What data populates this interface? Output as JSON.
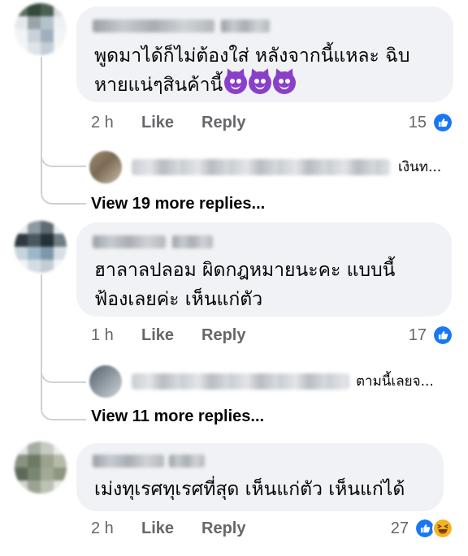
{
  "comments": [
    {
      "text_lines": [
        "พูดมาได้ก็ไม่ต้องใส่ หลังจากนี้แหละ ฉิบ",
        "หายแน่ๆสินค้านี้"
      ],
      "emoji": [
        "smiling-face-with-horns-emoji",
        "smiling-face-with-horns-emoji",
        "smiling-face-with-horns-emoji"
      ],
      "time": "2 h",
      "like_label": "Like",
      "reply_label": "Reply",
      "reaction_count": "15",
      "reactions": [
        "like-icon"
      ],
      "reply_preview_snippet": "เงินท...",
      "view_more": "View 19 more replies..."
    },
    {
      "text_lines": [
        "ฮาลาลปลอม  ผิดกฎหมายนะคะ  แบบนี้",
        "ฟ้องเลยค่ะ  เห็นแก่ตัว"
      ],
      "time": "1 h",
      "like_label": "Like",
      "reply_label": "Reply",
      "reaction_count": "17",
      "reactions": [
        "like-icon"
      ],
      "reply_preview_snippet": "ตามนี้เลยจ...",
      "view_more": "View 11 more replies..."
    },
    {
      "text_lines": [
        "เม่งทุเรศทุเรศที่สุด เห็นแก่ตัว เห็นแก่ได้"
      ],
      "time": "2 h",
      "like_label": "Like",
      "reply_label": "Reply",
      "reaction_count": "27",
      "reactions": [
        "like-icon",
        "haha-icon"
      ]
    }
  ],
  "colors": {
    "bubble": "#f0f2f5",
    "secondary_text": "#65676b",
    "like_blue": "#1877f2",
    "haha_yellow": "#f7b125"
  }
}
